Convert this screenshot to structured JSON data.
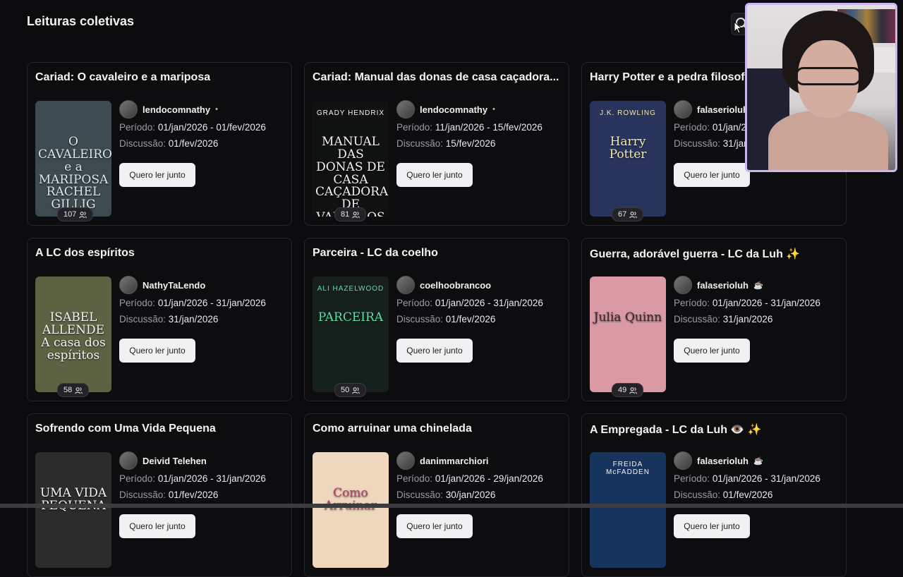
{
  "page": {
    "title": "Leituras coletivas"
  },
  "labels": {
    "period": "Período:",
    "discussion": "Discussão:"
  },
  "cards": [
    {
      "title": "Cariad: O cavaleiro e a mariposa",
      "host": "lendocomnathy",
      "host_suffix": "•",
      "period": "01/jan/2026 - 01/fev/2026",
      "discussion": "01/fev/2026",
      "button": "Quero ler junto",
      "participants": "107",
      "cover": {
        "author": "",
        "title": "O CAVALEIRO e a MARIPOSA\nRACHEL GILLIG",
        "bg": "#3d4a4f",
        "fg": "#dfe6e8"
      }
    },
    {
      "title": "Cariad: Manual das donas de casa caçadora...",
      "host": "lendocomnathy",
      "host_suffix": "•",
      "period": "11/jan/2026 - 15/fev/2026",
      "discussion": "15/fev/2026",
      "button": "Quero ler junto",
      "participants": "81",
      "cover": {
        "author": "GRADY HENDRIX",
        "title": "MANUAL DAS DONAS DE CASA CAÇADORAS DE VAMPIROS",
        "bg": "#0f1210",
        "fg": "#f2f2f2"
      }
    },
    {
      "title": "Harry Potter e a pedra filosofal",
      "host": "falaserioluh",
      "host_suffix": "",
      "period": "01/jan/2026 - 31/jan/2026",
      "discussion": "31/jan/2026",
      "button": "Quero ler junto",
      "participants": "67",
      "cover": {
        "author": "J.K. ROWLING",
        "title": "Harry Potter",
        "bg": "#28345c",
        "fg": "#f6e7a5"
      }
    },
    {
      "title": "A LC dos espíritos",
      "host": "NathyTaLendo",
      "host_suffix": "",
      "period": "01/jan/2026 - 31/jan/2026",
      "discussion": "31/jan/2026",
      "button": "Quero ler junto",
      "participants": "58",
      "cover": {
        "author": "",
        "title": "ISABEL ALLENDE\nA casa dos espíritos",
        "bg": "#5c6242",
        "fg": "#f3f3f3"
      }
    },
    {
      "title": "Parceira - LC da coelho",
      "host": "coelhoobrancoo",
      "host_suffix": "",
      "period": "01/jan/2026 - 31/jan/2026",
      "discussion": "01/fev/2026",
      "button": "Quero ler junto",
      "participants": "50",
      "cover": {
        "author": "ALI HAZELWOOD",
        "title": "PARCEIRA",
        "bg": "#15201c",
        "fg": "#5fe0a6"
      }
    },
    {
      "title": "Guerra, adorável guerra - LC da Luh ✨",
      "host": "falaserioluh",
      "host_suffix": "☕",
      "period": "01/jan/2026 - 31/jan/2026",
      "discussion": "31/jan/2026",
      "button": "Quero ler junto",
      "participants": "49",
      "cover": {
        "author": "",
        "title": "Julia Quinn",
        "bg": "#d99aa6",
        "fg": "#3a2a2a"
      }
    },
    {
      "title": "Sofrendo com Uma Vida Pequena",
      "host": "Deivid Telehen",
      "host_suffix": "",
      "period": "01/jan/2026 - 31/jan/2026",
      "discussion": "01/fev/2026",
      "button": "Quero ler junto",
      "participants": "",
      "cover": {
        "author": "",
        "title": "UMA VIDA PEQUENA",
        "bg": "#2c2c2c",
        "fg": "#f3f3f3"
      }
    },
    {
      "title": "Como arruinar uma chinelada",
      "host": "danimmarchiori",
      "host_suffix": "",
      "period": "01/jan/2026 - 29/jan/2026",
      "discussion": "30/jan/2026",
      "button": "Quero ler junto",
      "participants": "",
      "cover": {
        "author": "",
        "title": "Como Arruinar",
        "bg": "#efd7be",
        "fg": "#b4406b"
      }
    },
    {
      "title": "A Empregada - LC da Luh 👁️ ✨",
      "host": "falaserioluh",
      "host_suffix": "☕",
      "period": "01/jan/2026 - 31/jan/2026",
      "discussion": "01/fev/2026",
      "button": "Quero ler junto",
      "participants": "",
      "cover": {
        "author": "FREIDA McFADDEN",
        "title": "",
        "bg": "#17345e",
        "fg": "#f3f3f3"
      }
    }
  ]
}
